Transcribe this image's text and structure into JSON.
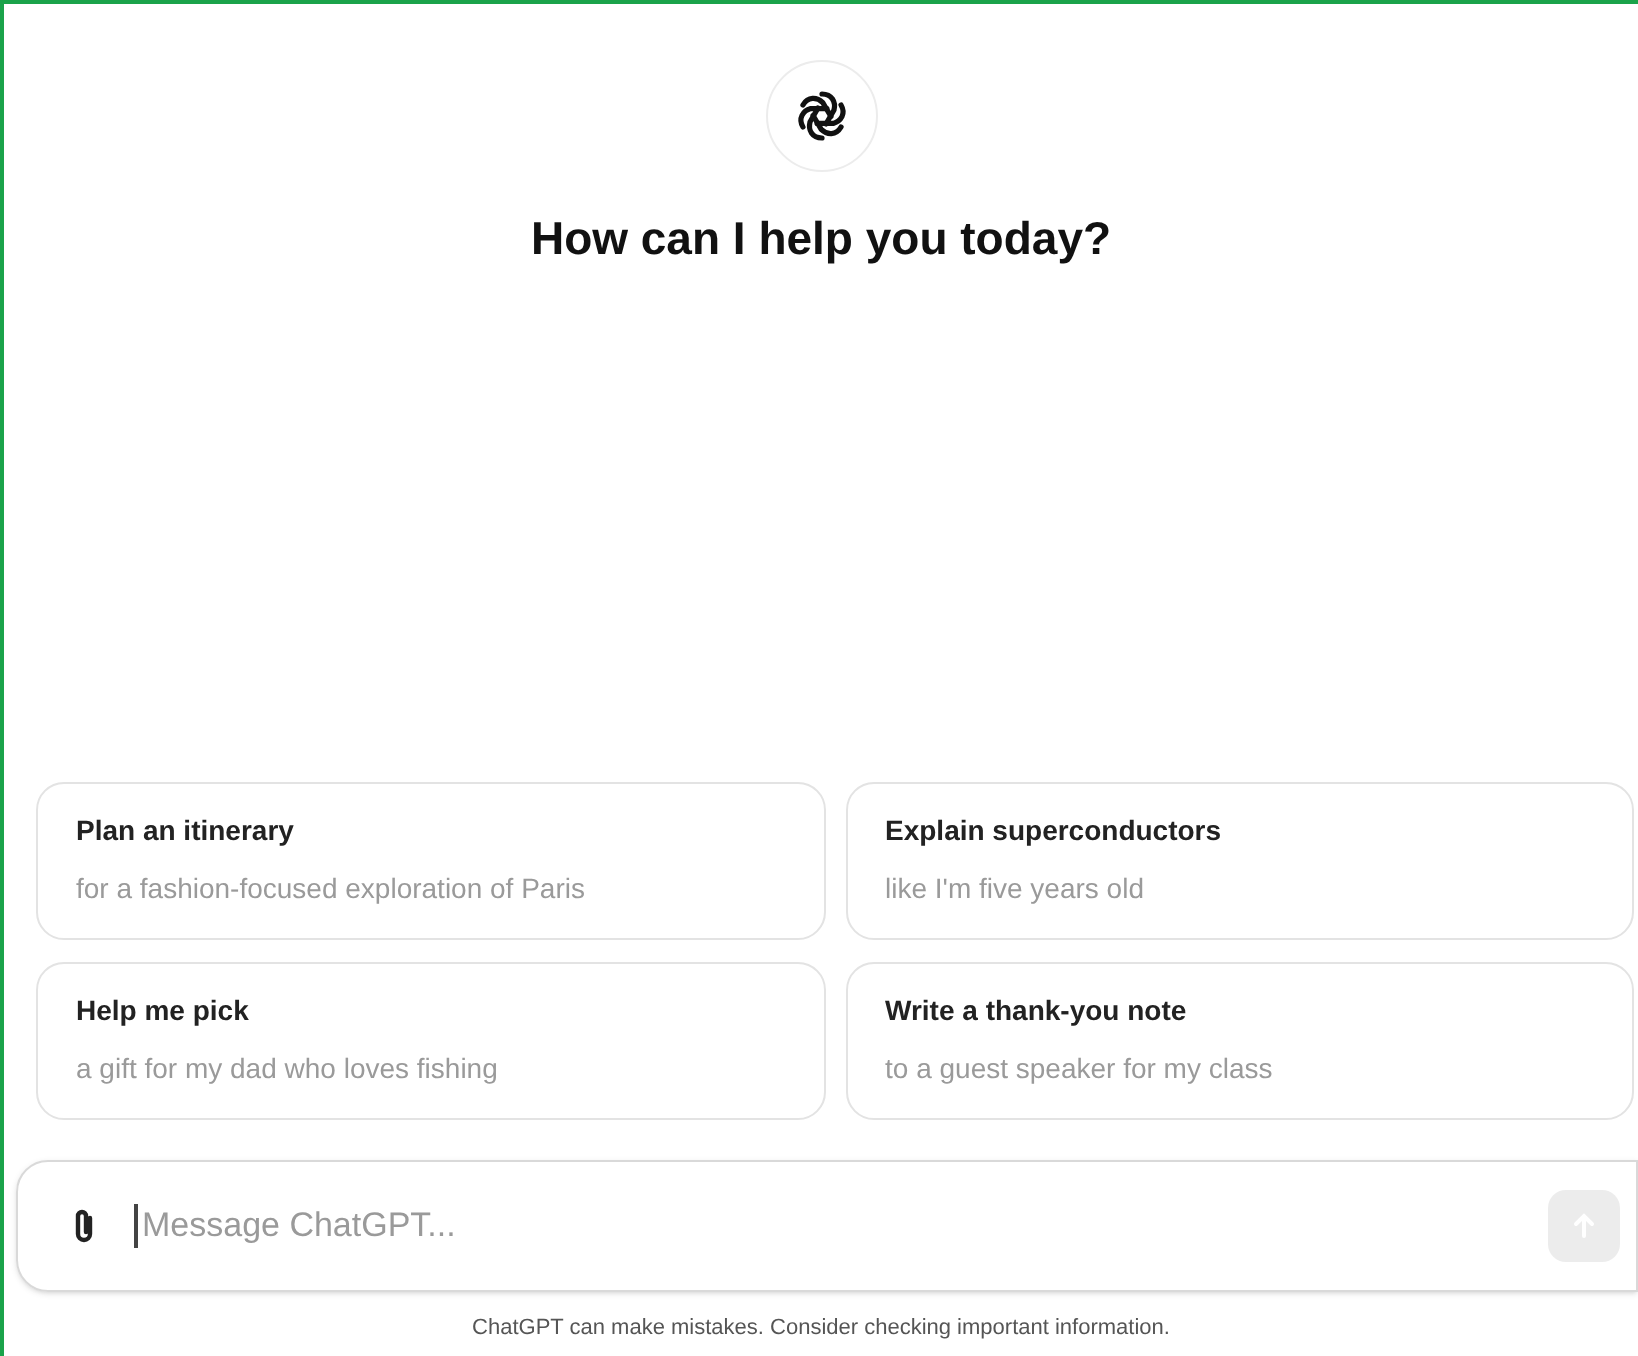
{
  "heading": "How can I help you today?",
  "suggestions": [
    {
      "title": "Plan an itinerary",
      "subtitle": "for a fashion-focused exploration of Paris"
    },
    {
      "title": "Explain superconductors",
      "subtitle": "like I'm five years old"
    },
    {
      "title": "Help me pick",
      "subtitle": "a gift for my dad who loves fishing"
    },
    {
      "title": "Write a thank-you note",
      "subtitle": "to a guest speaker for my class"
    }
  ],
  "composer": {
    "placeholder": "Message ChatGPT...",
    "send_disabled": true
  },
  "disclaimer": "ChatGPT can make mistakes. Consider checking important information."
}
